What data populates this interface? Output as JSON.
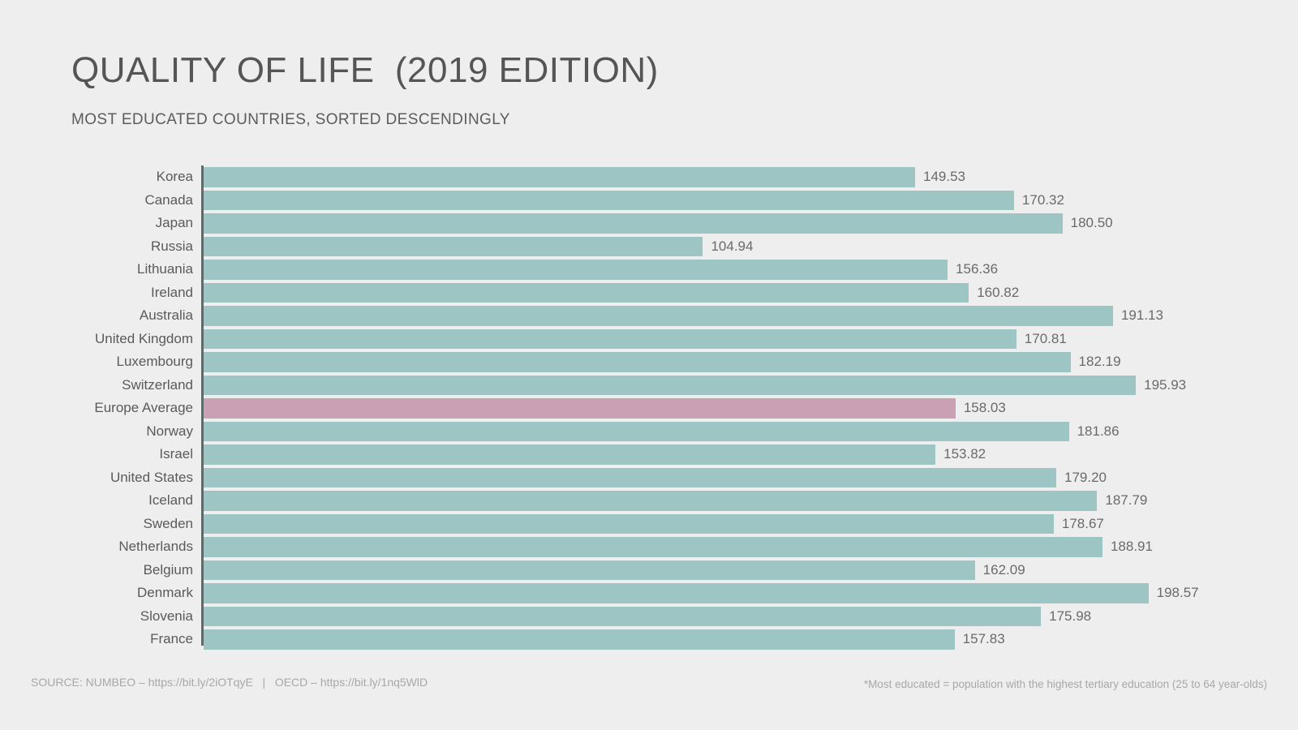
{
  "header": {
    "title": "QUALITY OF LIFE  (2019 EDITION)",
    "subtitle": "MOST EDUCATED COUNTRIES, SORTED DESCENDINGLY"
  },
  "footer": {
    "source": "SOURCE: NUMBEO – https://bit.ly/2iOTqyE   |   OECD – https://bit.ly/1nq5WlD",
    "note": "*Most educated = population with the highest tertiary education (25 to 64 year-olds)"
  },
  "colors": {
    "background": "#eeeeee",
    "bar": "#9cc5c3",
    "bar_highlight": "#c9a0b4",
    "axis": "#5f6b6b",
    "title_text": "#555555",
    "label_text": "#5a5a5a",
    "value_text": "#6a6a6a",
    "footer_text": "#a8a8a8"
  },
  "chart_data": {
    "type": "bar",
    "orientation": "horizontal",
    "title": "QUALITY OF LIFE  (2019 EDITION)",
    "subtitle": "MOST EDUCATED COUNTRIES, SORTED DESCENDINGLY",
    "xlabel": "",
    "ylabel": "",
    "xlim": [
      0,
      200
    ],
    "grid": false,
    "legend": false,
    "categories": [
      "Korea",
      "Canada",
      "Japan",
      "Russia",
      "Lithuania",
      "Ireland",
      "Australia",
      "United Kingdom",
      "Luxembourg",
      "Switzerland",
      "Europe Average",
      "Norway",
      "Israel",
      "United States",
      "Iceland",
      "Sweden",
      "Netherlands",
      "Belgium",
      "Denmark",
      "Slovenia",
      "France"
    ],
    "values": [
      149.53,
      170.32,
      180.5,
      104.94,
      156.36,
      160.82,
      191.13,
      170.81,
      182.19,
      195.93,
      158.03,
      181.86,
      153.82,
      179.2,
      187.79,
      178.67,
      188.91,
      162.09,
      198.57,
      175.98,
      157.83
    ],
    "value_labels": [
      "149.53",
      "170.32",
      "180.50",
      "104.94",
      "156.36",
      "160.82",
      "191.13",
      "170.81",
      "182.19",
      "195.93",
      "158.03",
      "181.86",
      "153.82",
      "179.20",
      "187.79",
      "178.67",
      "188.91",
      "162.09",
      "198.57",
      "175.98",
      "157.83"
    ],
    "highlight_index": 10,
    "highlight_category": "Europe Average"
  }
}
